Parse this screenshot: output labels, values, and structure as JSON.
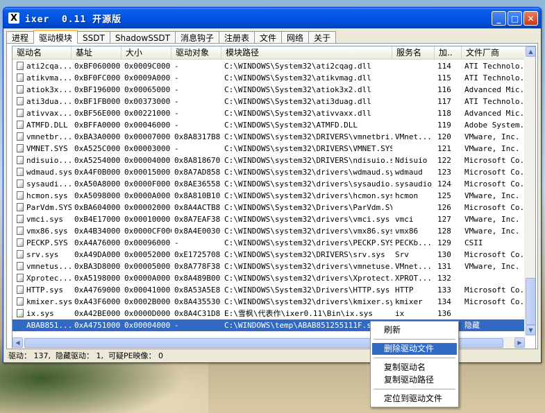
{
  "window": {
    "title": "ixer  0.11 开源版",
    "app_icon": "X",
    "minimize": "_",
    "maximize": "□",
    "close": "✕"
  },
  "tabs": [
    "进程",
    "驱动模块",
    "SSDT",
    "ShadowSSDT",
    "消息钩子",
    "注册表",
    "文件",
    "网络",
    "关于"
  ],
  "active_tab": "驱动模块",
  "columns": [
    "驱动名",
    "基址",
    "大小",
    "驱动对象",
    "模块路径",
    "服务名",
    "加..",
    "文件厂商"
  ],
  "rows": [
    [
      "ati2cqa...",
      "0xBF060000",
      "0x0009C000",
      "-",
      "C:\\WINDOWS\\System32\\ati2cqag.dll",
      "",
      "114",
      "ATI Technolo..."
    ],
    [
      "atikvma...",
      "0xBF0FC000",
      "0x0009A000",
      "-",
      "C:\\WINDOWS\\System32\\atikvmag.dll",
      "",
      "115",
      "ATI Technolo..."
    ],
    [
      "atiok3x...",
      "0xBF196000",
      "0x00065000",
      "-",
      "C:\\WINDOWS\\System32\\atiok3x2.dll",
      "",
      "116",
      "Advanced Mic..."
    ],
    [
      "ati3dua...",
      "0xBF1FB000",
      "0x00373000",
      "-",
      "C:\\WINDOWS\\System32\\ati3duag.dll",
      "",
      "117",
      "ATI Technolo..."
    ],
    [
      "ativvax...",
      "0xBF56E000",
      "0x00221000",
      "-",
      "C:\\WINDOWS\\System32\\ativvaxx.dll",
      "",
      "118",
      "Advanced Mic..."
    ],
    [
      "ATMFD.DLL",
      "0xBFFA0000",
      "0x00046000",
      "-",
      "C:\\WINDOWS\\System32\\ATMFD.DLL",
      "",
      "119",
      "Adobe System..."
    ],
    [
      "vmnetbr...",
      "0xBA3A0000",
      "0x00007000",
      "0x8A8317B8",
      "C:\\WINDOWS\\system32\\DRIVERS\\vmnetbri...",
      "VMnet...",
      "120",
      "VMware, Inc."
    ],
    [
      "VMNET.SYS",
      "0xA525C000",
      "0x00003000",
      "-",
      "C:\\WINDOWS\\system32\\DRIVERS\\VMNET.SYS",
      "",
      "121",
      "VMware, Inc."
    ],
    [
      "ndisuio...",
      "0xA5254000",
      "0x00004000",
      "0x8A818670",
      "C:\\WINDOWS\\system32\\DRIVERS\\ndisuio.sys",
      "Ndisuio",
      "122",
      "Microsoft Co..."
    ],
    [
      "wdmaud.sys",
      "0xA4F0B000",
      "0x00015000",
      "0x8A7AD858",
      "C:\\WINDOWS\\system32\\drivers\\wdmaud.sys",
      "wdmaud",
      "123",
      "Microsoft Co..."
    ],
    [
      "sysaudi...",
      "0xA50A8000",
      "0x0000F000",
      "0x8AE36558",
      "C:\\WINDOWS\\system32\\drivers\\sysaudio...",
      "sysaudio",
      "124",
      "Microsoft Co..."
    ],
    [
      "hcmon.sys",
      "0xA5098000",
      "0x0000A000",
      "0x8A810B10",
      "C:\\WINDOWS\\system32\\drivers\\hcmon.sys",
      "hcmon",
      "125",
      "VMware, Inc."
    ],
    [
      "ParVdm.SYS",
      "0xBA604000",
      "0x00002000",
      "0x8A4ACTB8",
      "C:\\WINDOWS\\System32\\Drivers\\ParVdm.SYS",
      "",
      "126",
      "Microsoft Co..."
    ],
    [
      "vmci.sys",
      "0xB4E17000",
      "0x00010000",
      "0x8A7EAF38",
      "C:\\WINDOWS\\system32\\drivers\\vmci.sys",
      "vmci",
      "127",
      "VMware, Inc."
    ],
    [
      "vmx86.sys",
      "0xA4B34000",
      "0x0000CF000",
      "0x8A4E0030",
      "C:\\WINDOWS\\system32\\drivers\\vmx86.sys",
      "vmx86",
      "128",
      "VMware, Inc."
    ],
    [
      "PECKP.SYS",
      "0xA4A76000",
      "0x00096000",
      "-",
      "C:\\WINDOWS\\system32\\drivers\\PECKP.SYS",
      "PECKb...",
      "129",
      "CSII"
    ],
    [
      "srv.sys",
      "0xA49DA000",
      "0x00052000",
      "0xE1725708",
      "C:\\WINDOWS\\system32\\DRIVERS\\srv.sys",
      "Srv",
      "130",
      "Microsoft Co..."
    ],
    [
      "vmnetus...",
      "0xBA3D8000",
      "0x00005000",
      "0x8A778F38",
      "C:\\WINDOWS\\system32\\drivers\\vmnetuse...",
      "VMnet...",
      "131",
      "VMware, Inc."
    ],
    [
      "Xprotec...",
      "0xA5198000",
      "0x0000A000",
      "0x8A489B00",
      "C:\\WINDOWS\\system32\\drivers\\Xprotect...",
      "XPROT...",
      "132",
      ""
    ],
    [
      "HTTP.sys",
      "0xA4769000",
      "0x00041000",
      "0x8A53A5E8",
      "C:\\WINDOWS\\System32\\Drivers\\HTTP.sys",
      "HTTP",
      "133",
      "Microsoft Co..."
    ],
    [
      "kmixer.sys",
      "0xA43F6000",
      "0x0002B000",
      "0x8A435530",
      "C:\\WINDOWS\\system32\\drivers\\kmixer.sys",
      "kmixer",
      "134",
      "Microsoft Co..."
    ],
    [
      "ix.sys",
      "0xA42BE000",
      "0x0000D000",
      "0x8A4C31D8",
      "E:\\雪枫\\代表作\\ixer0.11\\Bin\\ix.sys",
      "ix",
      "136",
      ""
    ],
    [
      "ABAB851...",
      "0xA4751000",
      "0x00004000",
      "-",
      "C:\\WINDOWS\\temp\\ABAB851255111F.sys",
      "",
      "1",
      "隐藏"
    ]
  ],
  "status": "驱动： 137,  隐藏驱动： 1,  可疑PE映像： 0",
  "context_menu": [
    "刷新",
    "删除驱动文件",
    "复制驱动名",
    "复制驱动路径",
    "定位到驱动文件"
  ]
}
